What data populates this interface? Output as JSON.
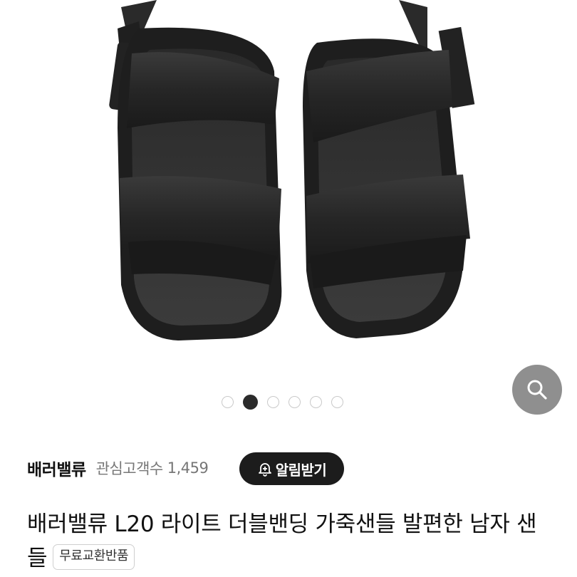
{
  "product_image": {
    "alt": "배러밸류 L20 라이트 더블밴딩 가죽샌들",
    "zoom_icon": "search-icon",
    "carousel": {
      "total": 6,
      "active_index": 1
    }
  },
  "store": {
    "brand": "배러밸류",
    "interest_label": "관심고객수",
    "interest_count": "1,459"
  },
  "alarm_button": {
    "label": "알림받기",
    "icon": "bell-plus-icon"
  },
  "product": {
    "title": "배러밸류 L20 라이트 더블밴딩 가죽샌들 발편한 남자 샌들",
    "badge": "무료교환반품"
  },
  "colors": {
    "dark": "#1c1c1c",
    "zoom_bg": "#8f8f8f",
    "muted_text": "#777777"
  }
}
